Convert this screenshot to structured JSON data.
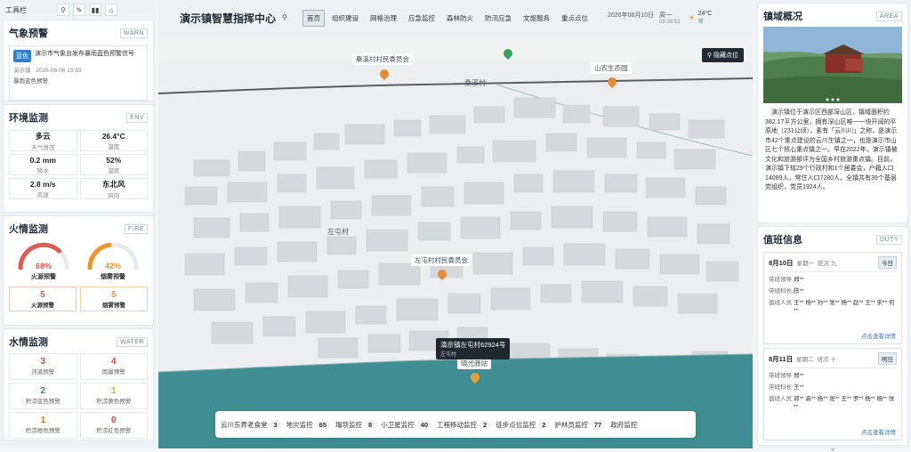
{
  "toolbar": {
    "label": "工具栏",
    "icons": [
      "pin-icon",
      "pencil-icon",
      "columns-icon",
      "home-icon"
    ]
  },
  "weather_warning": {
    "title": "气象预警",
    "tag": "WARN",
    "level": "蓝色",
    "text": "演示市气象台发布暴雨蓝色预警信号",
    "location": "演示镇",
    "time": "2026-08-06 15:55",
    "name": "暴雨蓝色预警"
  },
  "env": {
    "title": "环境监测",
    "tag": "ENV",
    "items": [
      {
        "value": "多云",
        "label": "天气情况"
      },
      {
        "value": "26.4°C",
        "label": "温度"
      },
      {
        "value": "0.2 mm",
        "label": "降水"
      },
      {
        "value": "52%",
        "label": "湿度"
      },
      {
        "value": "2.8 m/s",
        "label": "风速"
      },
      {
        "value": "东北风",
        "label": "风向"
      }
    ]
  },
  "fire": {
    "title": "火情监测",
    "tag": "FIRE",
    "gauges": [
      {
        "pct": "68%",
        "percent_value": 68,
        "label": "火源预警",
        "color": "#e05a4f"
      },
      {
        "pct": "42%",
        "percent_value": 42,
        "label": "烟雾预警",
        "color": "#f0932b"
      }
    ],
    "boxes": [
      {
        "value": "5",
        "label": "火源预警",
        "color": "#e05a4f"
      },
      {
        "value": "5",
        "label": "烟雾预警",
        "color": "#f0932b"
      }
    ]
  },
  "water": {
    "title": "水情监测",
    "tag": "WATER",
    "items": [
      {
        "value": "3",
        "label": "河道预警",
        "color": "#d9433a"
      },
      {
        "value": "4",
        "label": "雨量预警",
        "color": "#d9433a"
      },
      {
        "value": "2",
        "label": "积涝蓝色预警",
        "color": "#2f7fd0"
      },
      {
        "value": "1",
        "label": "积涝黄色预警",
        "color": "#e6a21a"
      },
      {
        "value": "1",
        "label": "积涝橙色预警",
        "color": "#e86d1e"
      },
      {
        "value": "0",
        "label": "积涝红色预警",
        "color": "#d9433a"
      }
    ]
  },
  "header": {
    "title": "演示镇智慧指挥中心",
    "tabs": [
      "首页",
      "组织建设",
      "网格治理",
      "应急监控",
      "森林防火",
      "防汛应急",
      "文旅服务",
      "重点点位"
    ],
    "date": "2026年08月10日",
    "weekday": "周一",
    "time": "09:38:52",
    "temp": "24°C",
    "weather": "晴"
  },
  "map": {
    "hide_button": "隐藏点位",
    "labels": [
      {
        "text": "桑溪村村民委员会"
      },
      {
        "text": "山农生态园"
      },
      {
        "text": "左屯村村民委员会"
      },
      {
        "text": "晓光驿站"
      }
    ],
    "place_names": [
      "桑溪村",
      "左屯村"
    ],
    "tooltip": {
      "title": "演示镇左屯村62924号",
      "sub": "左屯村"
    },
    "bottom_items": [
      {
        "label": "云川东养老食堂",
        "count": "3"
      },
      {
        "label": "地灾监控",
        "count": "65"
      },
      {
        "label": "塌坝监控",
        "count": "8"
      },
      {
        "label": "小卫星监控",
        "count": "40"
      },
      {
        "label": "工程移动监控",
        "count": "2"
      },
      {
        "label": "徒步点位监控",
        "count": "2"
      },
      {
        "label": "护林员监控",
        "count": "77"
      },
      {
        "label": "政府监控",
        "count": ""
      }
    ]
  },
  "overview": {
    "title": "镇域概况",
    "tag": "AREA",
    "text": "演示镇位于演示区西部深山区，镇域面积约382.17平方公里，拥有深山区唯一一块开阔的平原地（231公顷），素有「云川川」之称，是演示市42个重点建设的云川生镇之一，也是演示市山区七个核心重点镇之一。早在2022年，演示镇被文化和旅游部评为全国乡村旅游重点镇。目前，演示镇下辖29个行政村和1个居委会，户籍人口14089人，常住人口7280人，全镇共有39个基层党组织，党员1924人。"
  },
  "duty": {
    "title": "值班信息",
    "tag": "DUTY",
    "days": [
      {
        "date": "8月10日",
        "week": "星期一",
        "shift": "班次 九",
        "badge": "今日",
        "rows": [
          {
            "k": "带班领导",
            "v": "郑**"
          },
          {
            "k": "带班科长",
            "v": "陈**"
          },
          {
            "k": "值班人员",
            "v": "王** 杨** 孙** 张** 杨** 赵** 王** 宋** 何**"
          }
        ],
        "more": "点击查看详情"
      },
      {
        "date": "8月11日",
        "week": "星期二",
        "shift": "班次 十",
        "badge": "明日",
        "rows": [
          {
            "k": "带班领导",
            "v": "郑**"
          },
          {
            "k": "带班科长",
            "v": "王**"
          },
          {
            "k": "值班人员",
            "v": "郭** 高** 杨** 张** 王** 罗** 杨** 杨** 张**"
          }
        ],
        "more": "点击查看详情"
      }
    ]
  }
}
